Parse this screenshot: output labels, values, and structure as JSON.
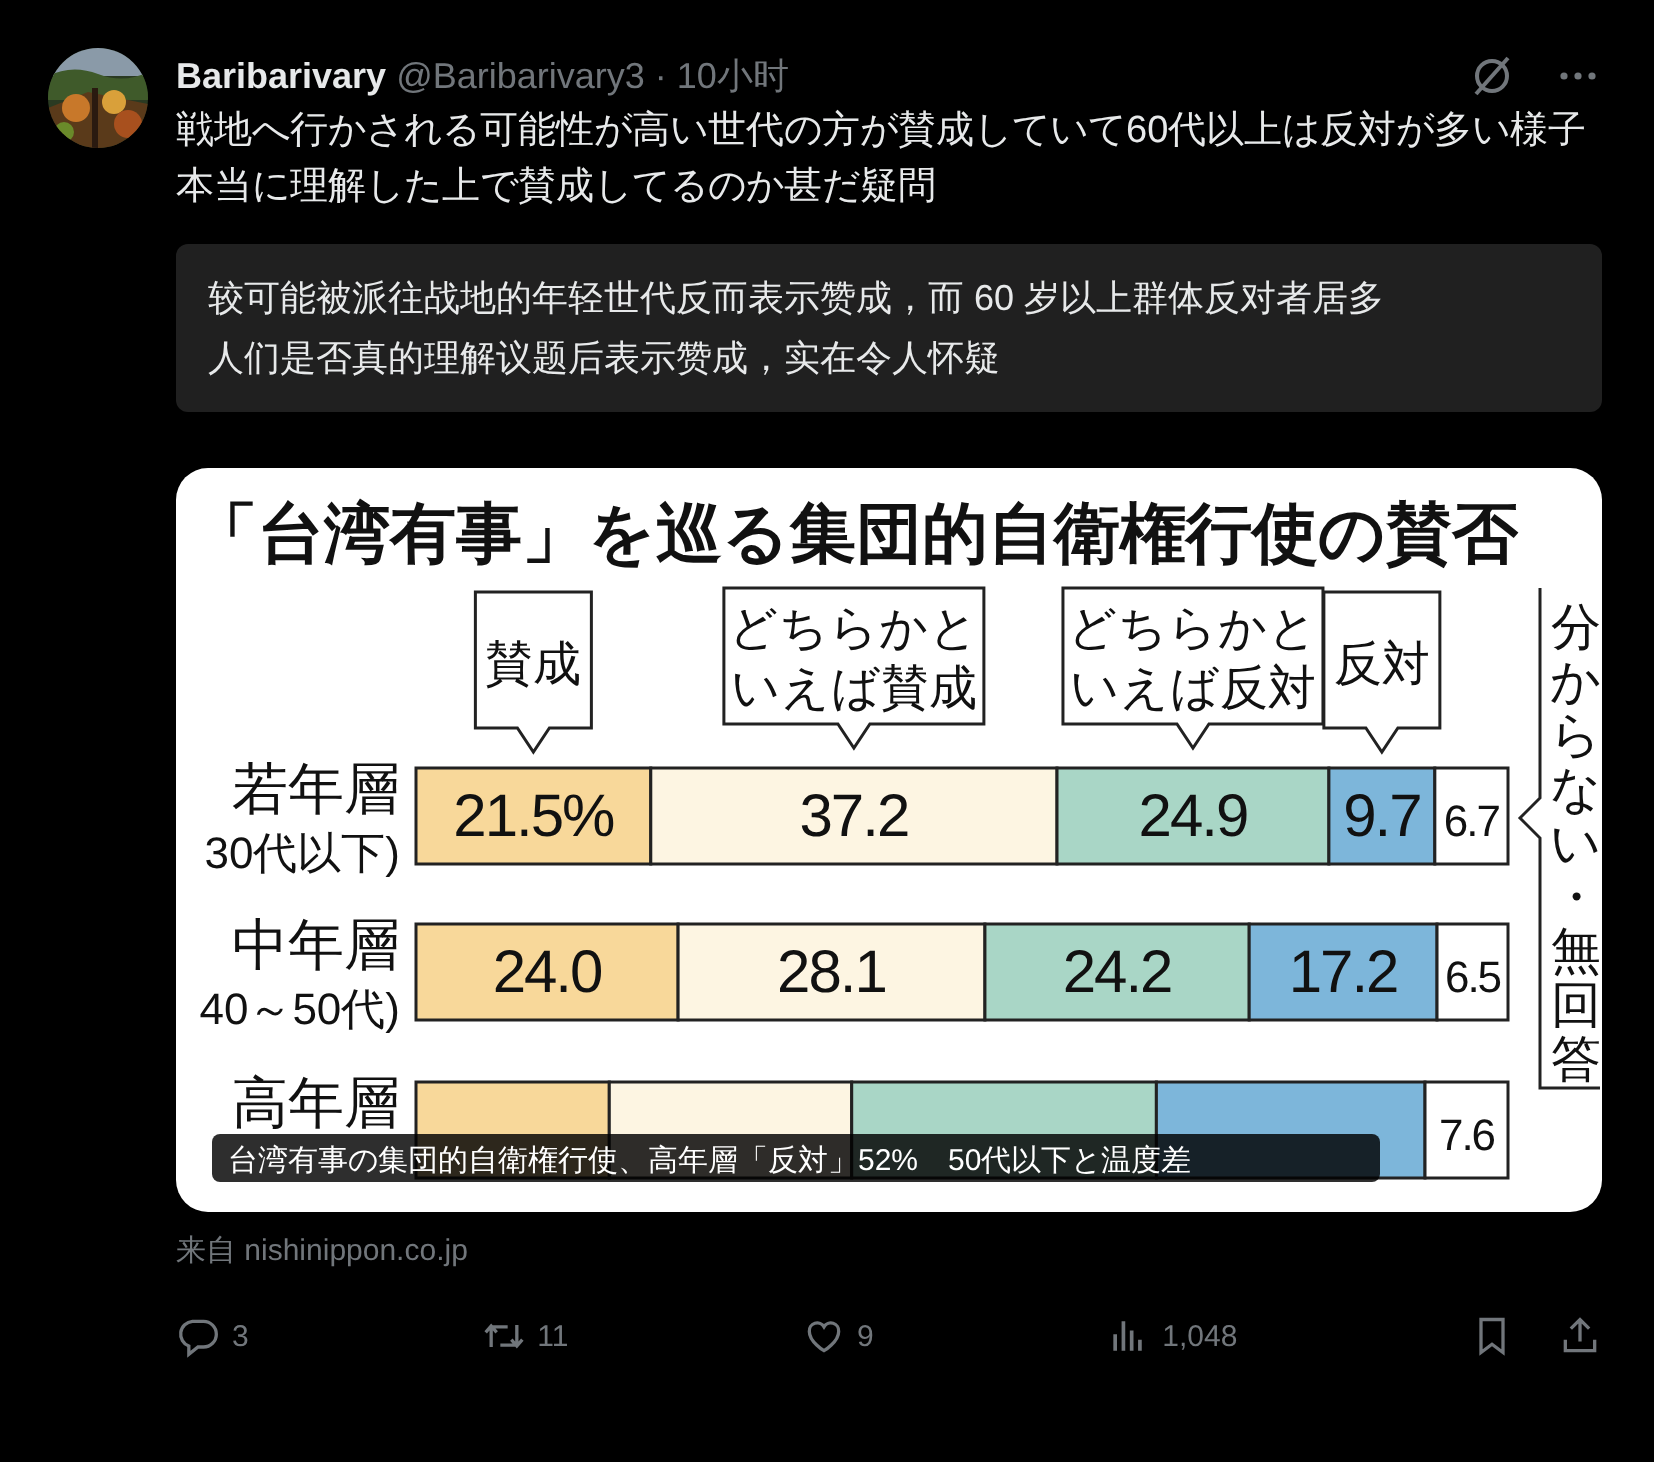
{
  "post": {
    "author": {
      "name": "Baribarivary",
      "handle": "@Baribarivary3",
      "separator": "·",
      "time": "10小时"
    },
    "paragraphs": [
      "戦地へ行かされる可能性が高い世代の方が賛成していて60代以上は反対が多い様子",
      "本当に理解した上で賛成してるのか甚だ疑問"
    ],
    "translation": [
      "较可能被派往战地的年轻世代反而表示赞成，而 60 岁以上群体反对者居多",
      "人们是否真的理解议题后表示赞成，实在令人怀疑"
    ],
    "card": {
      "chart_data": {
        "type": "bar",
        "orientation": "horizontal",
        "stacked": true,
        "title": "「台湾有事」を巡る集団的自衛権行使の賛否",
        "categories": [
          "若年層",
          "中年層",
          "高年層"
        ],
        "annotations": [
          "30代以下)",
          "40～50代)"
        ],
        "series": [
          {
            "name": "賛成",
            "color": "#f8d89a",
            "values": [
              21.5,
              24.0,
              17.7
            ],
            "value_labels": [
              "21.5%",
              "24.0",
              null
            ]
          },
          {
            "name": "どちらかといえば賛成",
            "color": "#fdf5e2",
            "values": [
              37.2,
              28.1,
              22.2
            ],
            "value_labels": [
              "37.2",
              "28.1",
              null
            ]
          },
          {
            "name": "どちらかといえば反対",
            "color": "#a9d6c6",
            "values": [
              24.9,
              24.2,
              27.9
            ],
            "value_labels": [
              "24.9",
              "24.2",
              null
            ]
          },
          {
            "name": "反対",
            "color": "#7db6da",
            "values": [
              9.7,
              17.2,
              24.6
            ],
            "value_labels": [
              "9.7",
              "17.2",
              null
            ]
          },
          {
            "name": "分からない・無回答",
            "color": "#ffffff",
            "values": [
              6.7,
              6.5,
              7.6
            ],
            "value_labels": [
              "6.7",
              "6.5",
              "7.6"
            ]
          }
        ],
        "data_labels": true
      },
      "caption": "台湾有事の集団的自衛権行使、高年層「反対」52%　50代以下と温度差",
      "source": "来自 nishinippon.co.jp"
    },
    "actions": [
      {
        "kind": "reply",
        "count": "3"
      },
      {
        "kind": "repost",
        "count": "11"
      },
      {
        "kind": "like",
        "count": "9"
      },
      {
        "kind": "views",
        "count": "1,048"
      },
      {
        "kind": "bookmark"
      },
      {
        "kind": "share"
      }
    ]
  }
}
